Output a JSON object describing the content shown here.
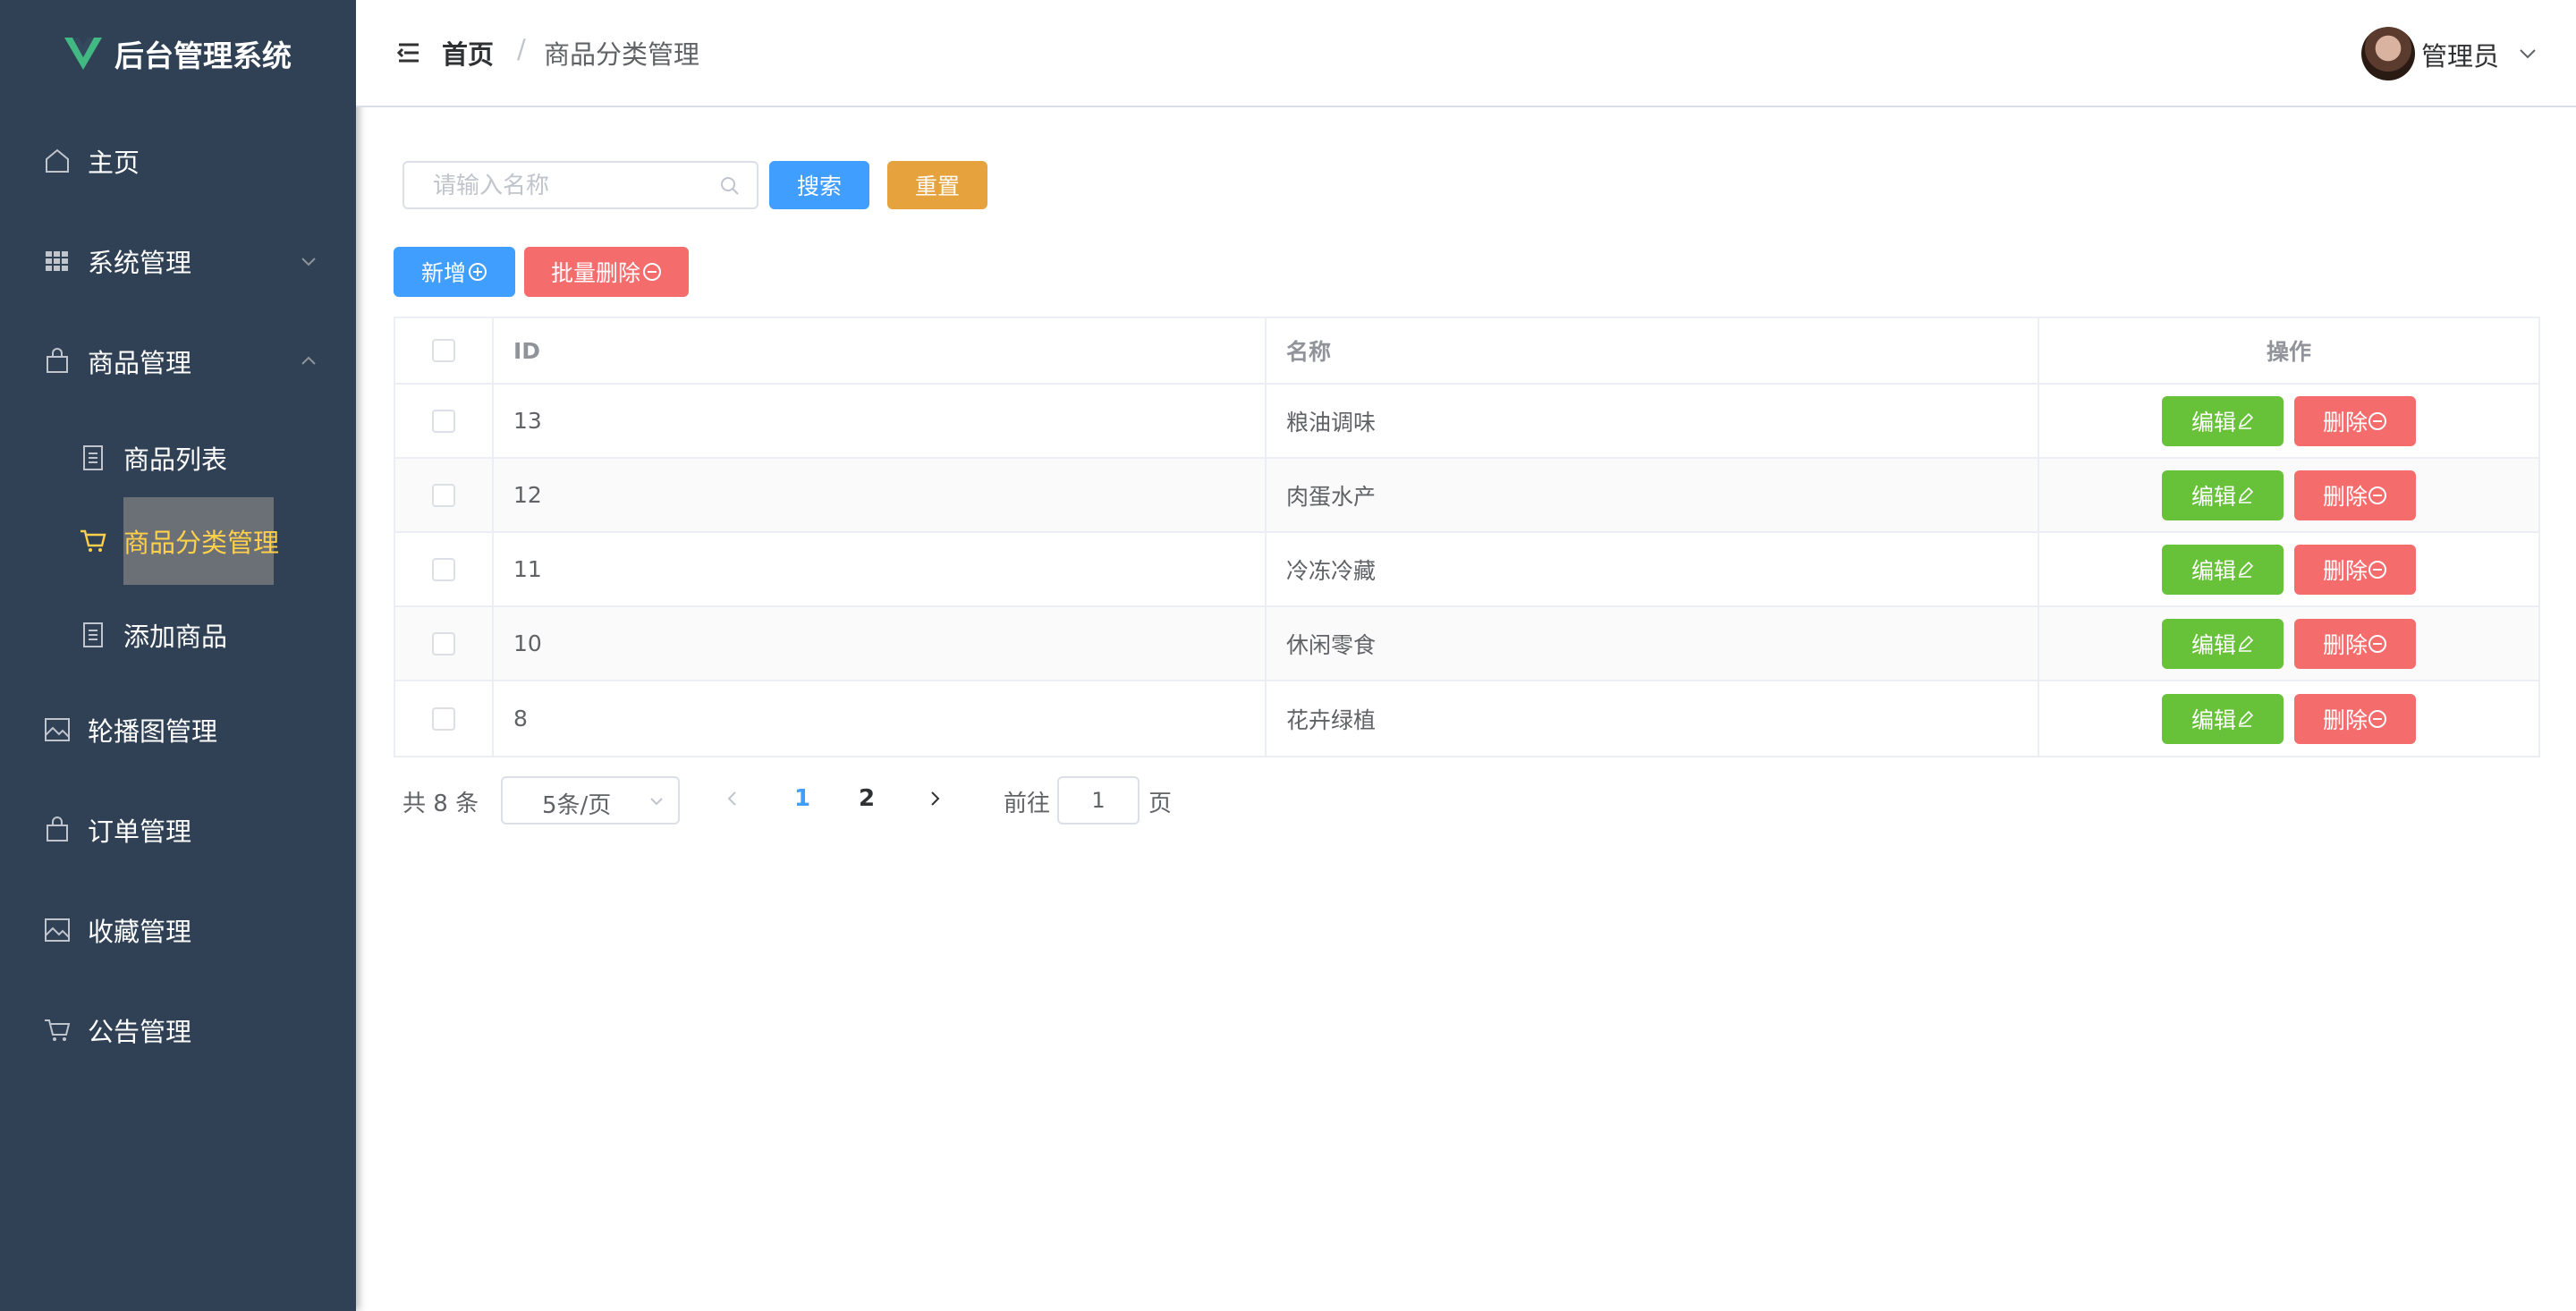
{
  "app": {
    "title": "后台管理系统"
  },
  "sidebar": {
    "items": [
      {
        "label": "主页",
        "icon": "home-icon"
      },
      {
        "label": "系统管理",
        "icon": "grid-icon",
        "expanded": false
      },
      {
        "label": "商品管理",
        "icon": "bag-icon",
        "expanded": true
      },
      {
        "label": "商品列表",
        "icon": "document-icon"
      },
      {
        "label": "商品分类管理",
        "icon": "cart-icon",
        "active": true
      },
      {
        "label": "添加商品",
        "icon": "document-icon"
      },
      {
        "label": "轮播图管理",
        "icon": "picture-icon"
      },
      {
        "label": "订单管理",
        "icon": "bag-icon"
      },
      {
        "label": "收藏管理",
        "icon": "picture-icon"
      },
      {
        "label": "公告管理",
        "icon": "cart-icon"
      }
    ]
  },
  "header": {
    "breadcrumb": {
      "home": "首页",
      "separator": "/",
      "current": "商品分类管理"
    },
    "user": {
      "name": "管理员"
    }
  },
  "toolbar": {
    "search_placeholder": "请输入名称",
    "search_label": "搜索",
    "reset_label": "重置",
    "add_label": "新增",
    "batch_delete_label": "批量删除"
  },
  "table": {
    "headers": {
      "id": "ID",
      "name": "名称",
      "op": "操作"
    },
    "rows": [
      {
        "id": "13",
        "name": "粮油调味"
      },
      {
        "id": "12",
        "name": "肉蛋水产"
      },
      {
        "id": "11",
        "name": "冷冻冷藏"
      },
      {
        "id": "10",
        "name": "休闲零食"
      },
      {
        "id": "8",
        "name": "花卉绿植"
      }
    ],
    "edit_label": "编辑",
    "delete_label": "删除"
  },
  "pagination": {
    "total_text": "共 8 条",
    "page_size": "5条/页",
    "pages": [
      "1",
      "2"
    ],
    "current_page": "1",
    "goto_label": "前往",
    "goto_value": "1",
    "page_suffix": "页"
  },
  "colors": {
    "sidebar_bg": "#304156",
    "primary": "#409eff",
    "warning": "#e6a23c",
    "success": "#67c23a",
    "danger": "#f56c6c",
    "logo_green": "#42b983",
    "active_icon": "#ffd04b"
  }
}
